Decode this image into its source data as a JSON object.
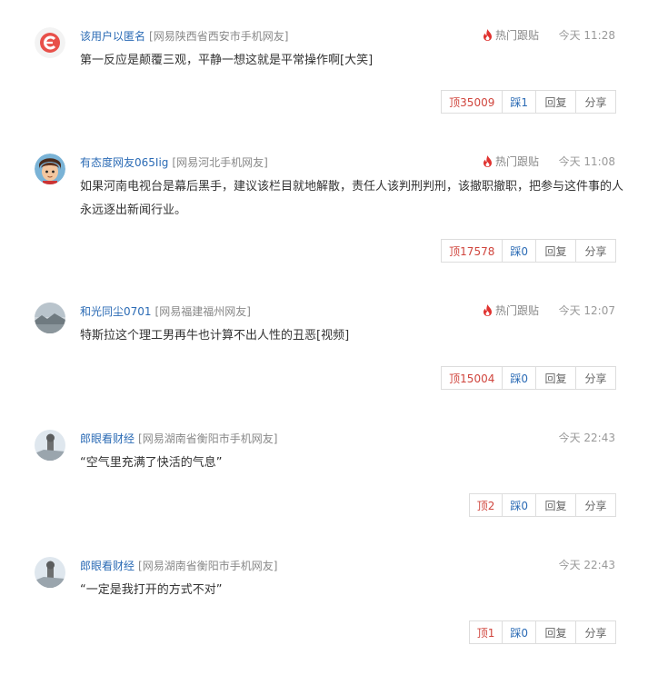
{
  "labels": {
    "hot": "热门跟贴",
    "reply": "回复",
    "share": "分享"
  },
  "colors": {
    "username": "#2b6bb5",
    "up_vote": "#d0453d",
    "down_vote": "#2b6bb5",
    "hot_flame": "#e0322f"
  },
  "comments": [
    {
      "avatar_icon": "netease-logo-avatar",
      "user": "该用户以匿名",
      "location": "[网易陕西省西安市手机网友]",
      "hot": true,
      "time": "今天 11:28",
      "text": "第一反应是颠覆三观，平静一想这就是平常操作啊[大笑]",
      "up": "顶35009",
      "down": "踩1"
    },
    {
      "avatar_icon": "cartoon-boy-avatar",
      "user": "有态度网友065Iig",
      "location": "[网易河北手机网友]",
      "hot": true,
      "time": "今天 11:08",
      "text": "如果河南电视台是幕后黑手，建议该栏目就地解散，责任人该判刑判刑，该撤职撤职，把参与这件事的人永远逐出新闻行业。",
      "up": "顶17578",
      "down": "踩0"
    },
    {
      "avatar_icon": "landscape-avatar",
      "user": "和光同尘0701",
      "location": "[网易福建福州网友]",
      "hot": true,
      "time": "今天 12:07",
      "text": "特斯拉这个理工男再牛也计算不出人性的丑恶[视频]",
      "up": "顶15004",
      "down": "踩0"
    },
    {
      "avatar_icon": "statue-avatar",
      "user": "郎眼看财经",
      "location": "[网易湖南省衡阳市手机网友]",
      "hot": false,
      "time": "今天 22:43",
      "text": "“空气里充满了快活的气息”",
      "up": "顶2",
      "down": "踩0"
    },
    {
      "avatar_icon": "statue-avatar",
      "user": "郎眼看财经",
      "location": "[网易湖南省衡阳市手机网友]",
      "hot": false,
      "time": "今天 22:43",
      "text": "“一定是我打开的方式不对”",
      "up": "顶1",
      "down": "踩0"
    }
  ]
}
